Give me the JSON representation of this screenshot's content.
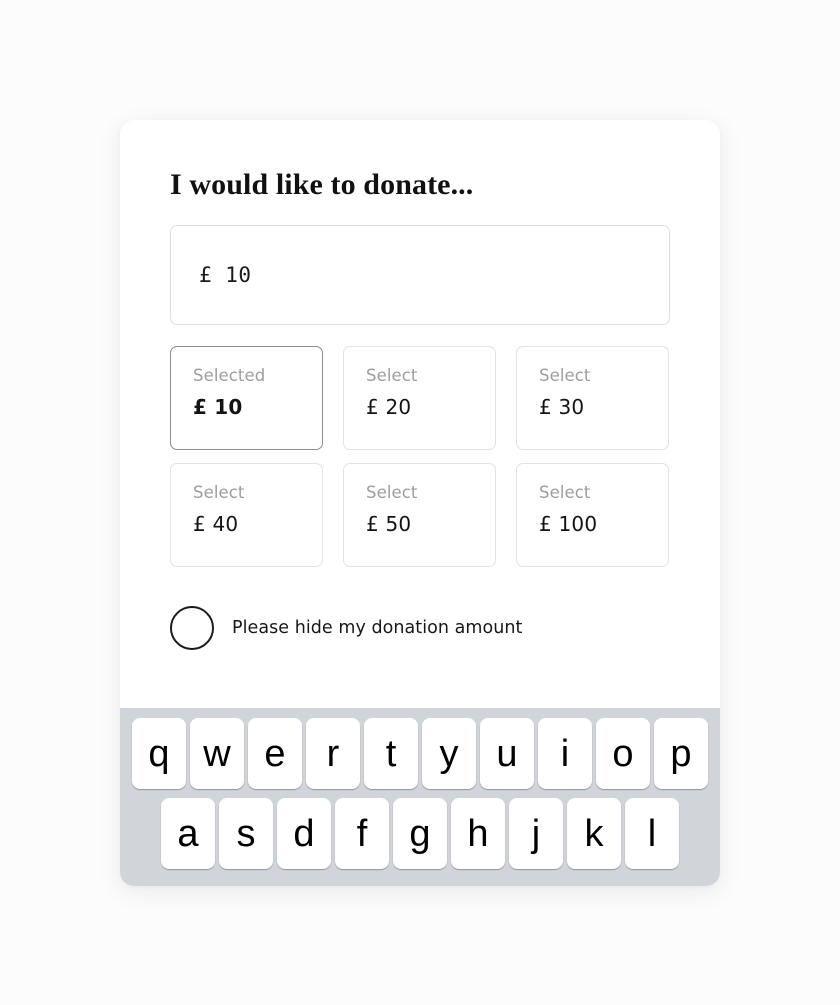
{
  "form": {
    "heading": "I would like to donate...",
    "amount_input": {
      "value": "£  10",
      "placeholder": "£"
    },
    "presets": [
      {
        "state": "Selected",
        "amount": "£ 10",
        "selected": true
      },
      {
        "state": "Select",
        "amount": "£ 20",
        "selected": false
      },
      {
        "state": "Select",
        "amount": "£ 30",
        "selected": false
      },
      {
        "state": "Select",
        "amount": "£ 40",
        "selected": false
      },
      {
        "state": "Select",
        "amount": "£ 50",
        "selected": false
      },
      {
        "state": "Select",
        "amount": "£ 100",
        "selected": false
      }
    ],
    "hide_option": {
      "label": "Please hide my donation amount",
      "checked": false
    }
  },
  "keyboard": {
    "rows": [
      [
        "q",
        "w",
        "e",
        "r",
        "t",
        "y",
        "u",
        "i",
        "o",
        "p"
      ],
      [
        "a",
        "s",
        "d",
        "f",
        "g",
        "h",
        "j",
        "k",
        "l"
      ]
    ]
  },
  "colors": {
    "page_background": "#fcfcfc",
    "card_background": "#ffffff",
    "keyboard_background": "#d1d5da",
    "key_background": "#ffffff",
    "border_default": "#e3e3e3",
    "border_selected": "#8d8d8d",
    "text_primary": "#131313",
    "text_muted": "#9d9d9d"
  }
}
